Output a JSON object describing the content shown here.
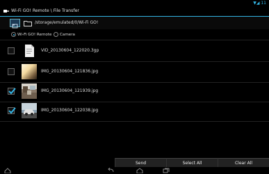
{
  "status": {
    "icons": "▼◢ 11"
  },
  "title": "Wi-Fi GO! Remote \\ File Transfer",
  "path": "/storage/emulated/0/Wi-Fi GO!",
  "radios": [
    {
      "label": "Wi-Fi GO! Remote",
      "selected": true
    },
    {
      "label": "Camera",
      "selected": false
    }
  ],
  "files": [
    {
      "name": "VID_20130604_122020.3gp",
      "checked": false,
      "thumb": "document-icon"
    },
    {
      "name": "IMG_20130604_121836.jpg",
      "checked": false,
      "thumb": "light-photo"
    },
    {
      "name": "IMG_20130604_121939.jpg",
      "checked": true,
      "thumb": "room-photo"
    },
    {
      "name": "IMG_20130604_122038.jpg",
      "checked": true,
      "thumb": "car-photo"
    }
  ],
  "buttons": {
    "send": "Send",
    "select_all": "Select All",
    "clear_all": "Clear All"
  },
  "colors": {
    "accent": "#33b5e5",
    "background": "#000000"
  }
}
